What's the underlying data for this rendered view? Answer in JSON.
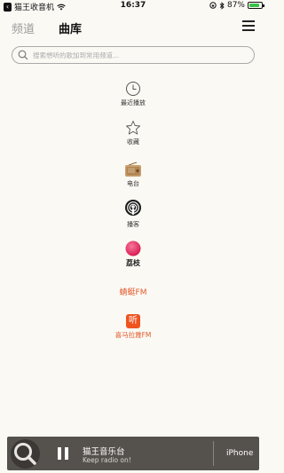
{
  "status_bar": {
    "back_app": "猫王收音机",
    "time": "16:37",
    "battery": "87%",
    "battery_level": 0.87
  },
  "header": {
    "tab_channel": "频道",
    "tab_library": "曲库"
  },
  "search": {
    "placeholder": "搜索想听的歌加到常用频道..."
  },
  "library": {
    "recent": "最近播放",
    "favorites": "收藏",
    "radio": "电台",
    "podcast": "播客",
    "lizhi": "荔枝",
    "qingting": "蜻蜓FM",
    "ximalaya_icon": "听",
    "ximalaya": "喜马拉雅FM"
  },
  "player": {
    "title": "猫王音乐台",
    "subtitle": "Keep radio on!",
    "device": "iPhone"
  }
}
